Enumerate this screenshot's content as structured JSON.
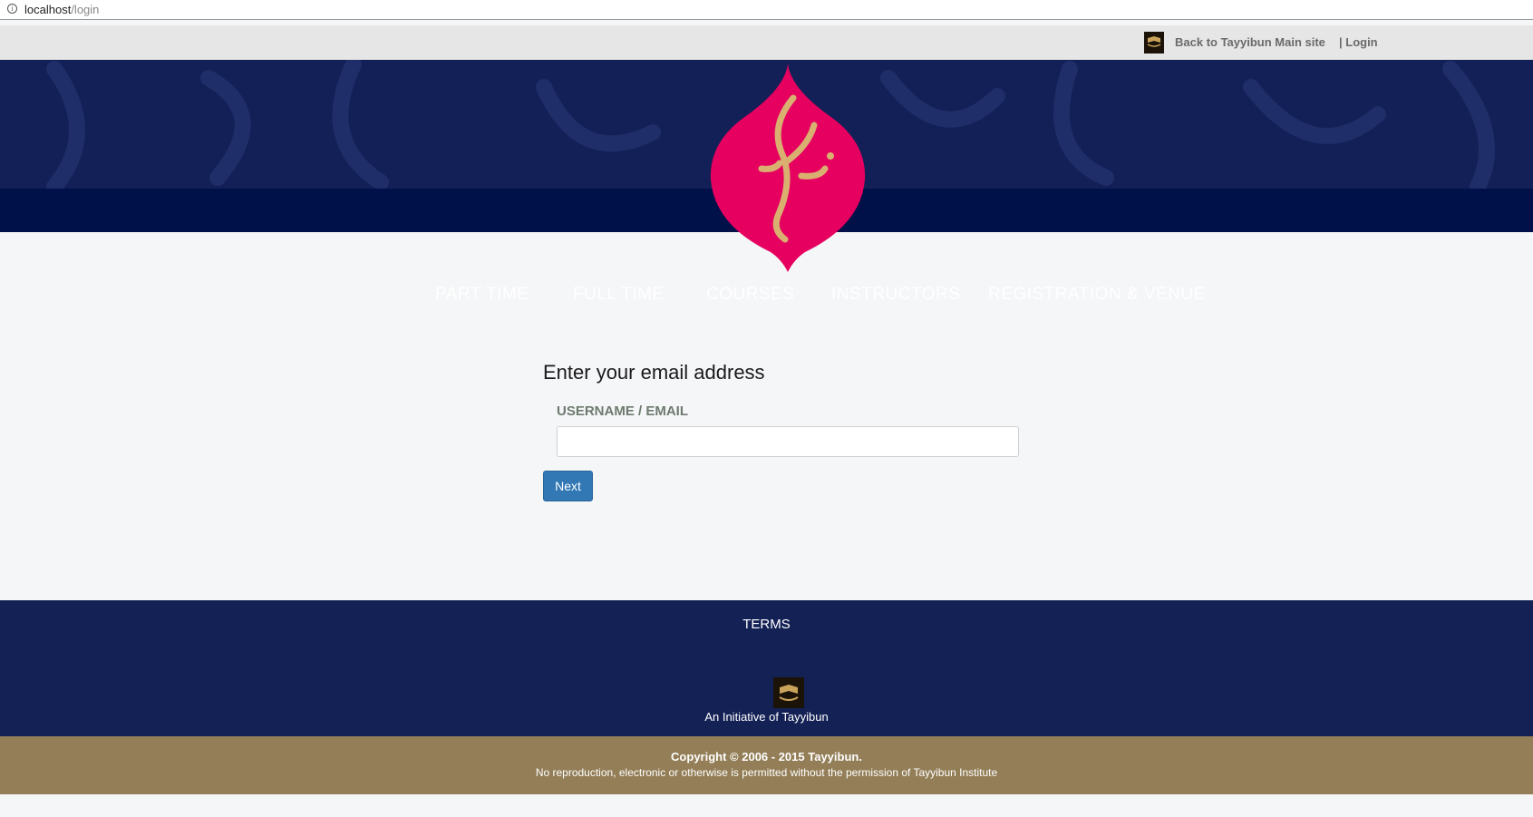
{
  "browser": {
    "url_host": "localhost",
    "url_path": "/login"
  },
  "topbar": {
    "back_label": "Back to Tayyibun Main site",
    "login_label": "| Login"
  },
  "nav": {
    "items": [
      "PART TIME",
      "FULL TIME",
      "COURSES",
      "INSTRUCTORS",
      "REGISTRATION & VENUE"
    ]
  },
  "form": {
    "title": "Enter your email address",
    "field_label": "USERNAME / EMAIL",
    "field_value": "",
    "next_label": "Next"
  },
  "footer": {
    "terms_label": "TERMS",
    "initiative": "An Initiative of Tayyibun",
    "copyright": "Copyright © 2006 - 2015 Tayyibun.",
    "notice": "No reproduction, electronic or otherwise is permitted without the permission of Tayyibun Institute"
  },
  "colors": {
    "header_navy": "#132057",
    "header_dark": "#001048",
    "emblem_pink": "#e6005f",
    "emblem_gold": "#d9b070",
    "button_blue": "#3178b5",
    "footer_gold": "#937e57"
  },
  "icons": [
    "info-icon",
    "tayyibun-logo",
    "aqsa-emblem"
  ]
}
